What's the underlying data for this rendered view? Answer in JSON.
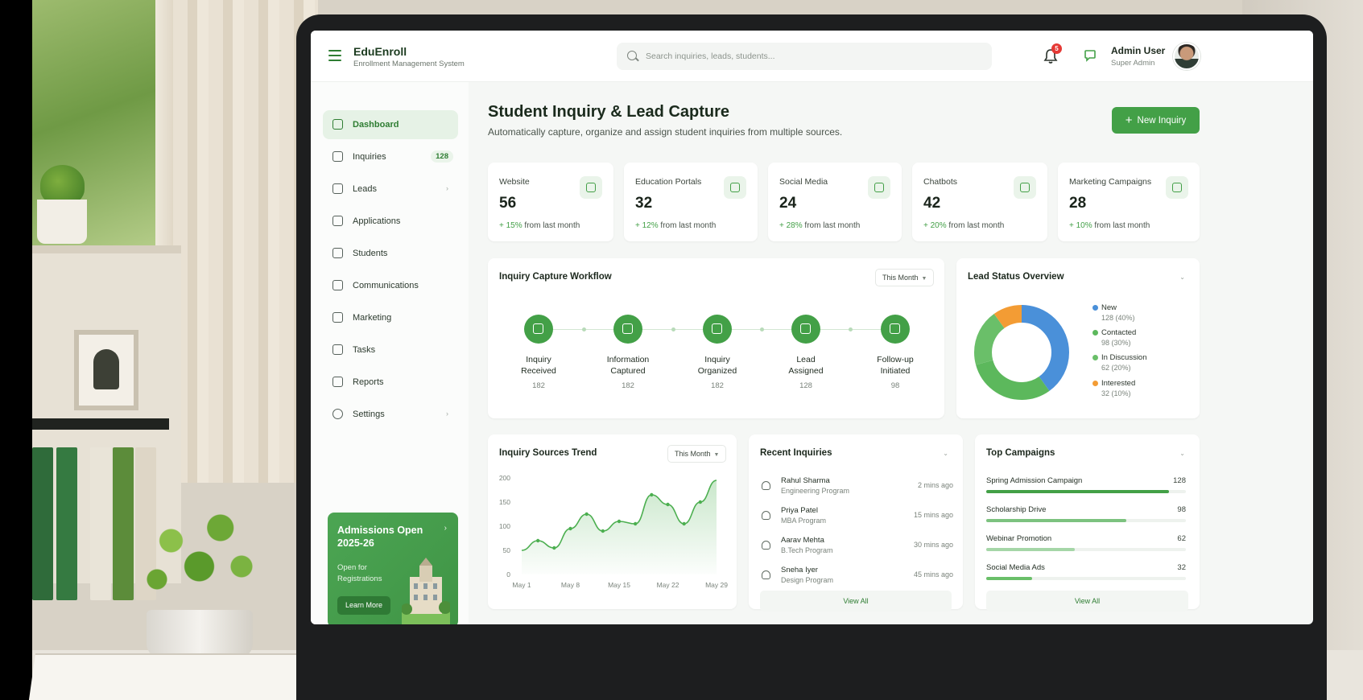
{
  "app": {
    "brand_title": "EduEnroll",
    "brand_subtitle": "Enrollment Management System"
  },
  "search": {
    "placeholder": "Search inquiries, leads, students..."
  },
  "header": {
    "notification_count": "5",
    "user_name": "Admin User",
    "user_role": "Super Admin"
  },
  "sidebar": {
    "items": [
      {
        "label": "Dashboard",
        "icon": "dashboard-icon",
        "active": true
      },
      {
        "label": "Inquiries",
        "icon": "inbox-icon",
        "badge": "128"
      },
      {
        "label": "Leads",
        "icon": "users-icon",
        "chevron": true
      },
      {
        "label": "Applications",
        "icon": "file-icon"
      },
      {
        "label": "Students",
        "icon": "student-icon"
      },
      {
        "label": "Communications",
        "icon": "chat-icon"
      },
      {
        "label": "Marketing",
        "icon": "megaphone-icon"
      },
      {
        "label": "Tasks",
        "icon": "checklist-icon"
      },
      {
        "label": "Reports",
        "icon": "report-icon"
      },
      {
        "label": "Settings",
        "icon": "gear-icon",
        "chevron": true
      }
    ],
    "promo": {
      "title": "Admissions Open 2025-26",
      "subtitle": "Open for Registrations",
      "button": "Learn More"
    }
  },
  "page": {
    "title": "Student Inquiry & Lead Capture",
    "subtitle": "Automatically capture, organize and assign student inquiries from multiple sources.",
    "new_button": "New Inquiry"
  },
  "stats": [
    {
      "label": "Website",
      "value": "56",
      "change": "+ 15%",
      "suffix": "from last month",
      "icon": "globe-icon"
    },
    {
      "label": "Education Portals",
      "value": "32",
      "change": "+ 12%",
      "suffix": "from last month",
      "icon": "portal-icon"
    },
    {
      "label": "Social Media",
      "value": "24",
      "change": "+ 28%",
      "suffix": "from last month",
      "icon": "share-icon"
    },
    {
      "label": "Chatbots",
      "value": "42",
      "change": "+ 20%",
      "suffix": "from last month",
      "icon": "bot-icon"
    },
    {
      "label": "Marketing Campaigns",
      "value": "28",
      "change": "+ 10%",
      "suffix": "from last month",
      "icon": "campaign-icon"
    }
  ],
  "workflow": {
    "title": "Inquiry Capture Workflow",
    "filter": "This Month",
    "steps": [
      {
        "label_1": "Inquiry",
        "label_2": "Received",
        "count": "182",
        "icon": "inbox-icon"
      },
      {
        "label_1": "Information",
        "label_2": "Captured",
        "count": "182",
        "icon": "form-icon"
      },
      {
        "label_1": "Inquiry",
        "label_2": "Organized",
        "count": "182",
        "icon": "folder-icon"
      },
      {
        "label_1": "Lead",
        "label_2": "Assigned",
        "count": "128",
        "icon": "assign-icon"
      },
      {
        "label_1": "Follow-up",
        "label_2": "Initiated",
        "count": "98",
        "icon": "phone-icon"
      }
    ]
  },
  "lead_status": {
    "title": "Lead Status Overview",
    "legend": [
      {
        "name": "New",
        "detail": "128 (40%)"
      },
      {
        "name": "Contacted",
        "detail": "98 (30%)"
      },
      {
        "name": "In Discussion",
        "detail": "62 (20%)"
      },
      {
        "name": "Interested",
        "detail": "32 (10%)"
      }
    ]
  },
  "trend": {
    "title": "Inquiry Sources Trend",
    "filter": "This Month"
  },
  "recent": {
    "title": "Recent Inquiries",
    "rows": [
      {
        "name": "Rahul Sharma",
        "program": "Engineering Program",
        "time": "2 mins ago"
      },
      {
        "name": "Priya Patel",
        "program": "MBA Program",
        "time": "15 mins ago"
      },
      {
        "name": "Aarav Mehta",
        "program": "B.Tech Program",
        "time": "30 mins ago"
      },
      {
        "name": "Sneha Iyer",
        "program": "Design Program",
        "time": "45 mins ago"
      }
    ],
    "view_all": "View All"
  },
  "campaigns": {
    "title": "Top Campaigns",
    "rows": [
      {
        "name": "Spring Admission Campaign",
        "value": 128,
        "value_label": "128"
      },
      {
        "name": "Scholarship Drive",
        "value": 98,
        "value_label": "98"
      },
      {
        "name": "Webinar Promotion",
        "value": 62,
        "value_label": "62"
      },
      {
        "name": "Social Media Ads",
        "value": 32,
        "value_label": "32"
      }
    ],
    "max": 140,
    "view_all": "View All"
  },
  "colors": {
    "primary": "#43a047",
    "blue": "#4a90d9",
    "green": "#5cb85c",
    "mid_green": "#6abf69",
    "orange": "#f39c34"
  },
  "chart_data": [
    {
      "type": "pie",
      "categories": [
        "New",
        "Contacted",
        "In Discussion",
        "Interested"
      ],
      "values": [
        128,
        98,
        62,
        32
      ],
      "colors": [
        "#4a90d9",
        "#5cb85c",
        "#6abf69",
        "#f39c34"
      ],
      "title": "Lead Status Overview"
    },
    {
      "type": "area",
      "title": "Inquiry Sources Trend",
      "x": [
        "May 1",
        "May 4",
        "May 6",
        "May 8",
        "May 11",
        "May 13",
        "May 15",
        "May 17",
        "May 19",
        "May 22",
        "May 24",
        "May 26",
        "May 29"
      ],
      "tick_labels": [
        "May 1",
        "May 8",
        "May 15",
        "May 22",
        "May 29"
      ],
      "values": [
        50,
        70,
        55,
        95,
        125,
        90,
        110,
        105,
        165,
        145,
        105,
        150,
        195
      ],
      "ylim": [
        0,
        200
      ],
      "yticks": [
        0,
        50,
        100,
        150,
        200
      ],
      "xlabel": "",
      "ylabel": ""
    }
  ]
}
